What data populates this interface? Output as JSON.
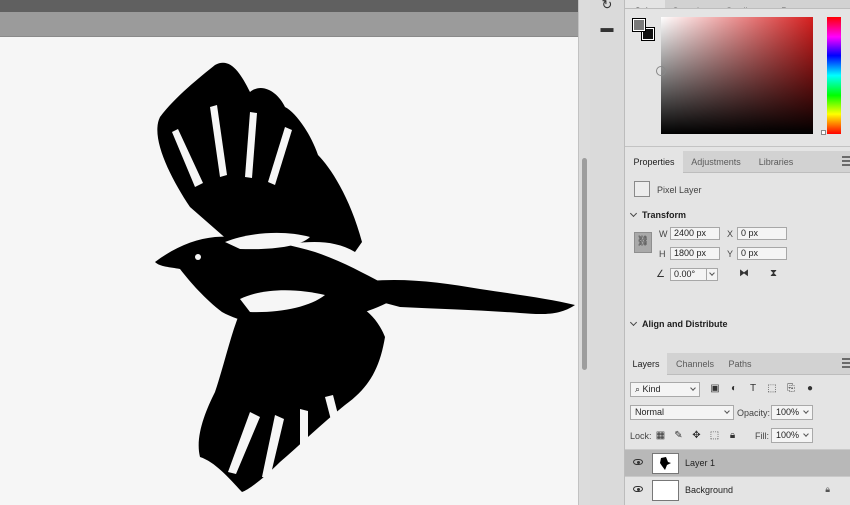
{
  "color_panel": {
    "tabs": [
      "Color",
      "Swatches",
      "Gradients",
      "Patterns"
    ]
  },
  "properties": {
    "tabs": [
      "Properties",
      "Adjustments",
      "Libraries"
    ],
    "layer_type": "Pixel Layer",
    "transform": {
      "title": "Transform",
      "w_label": "W",
      "w_value": "2400 px",
      "x_label": "X",
      "x_value": "0 px",
      "h_label": "H",
      "h_value": "1800 px",
      "y_label": "Y",
      "y_value": "0 px",
      "angle_value": "0.00°"
    },
    "align": {
      "title": "Align and Distribute"
    }
  },
  "layers_panel": {
    "tabs": [
      "Layers",
      "Channels",
      "Paths"
    ],
    "filter_kind": "Kind",
    "blend_mode": "Normal",
    "opacity_label": "Opacity:",
    "opacity_value": "100%",
    "lock_label": "Lock:",
    "fill_label": "Fill:",
    "fill_value": "100%",
    "layers": [
      {
        "name": "Layer 1",
        "selected": true
      },
      {
        "name": "Background",
        "locked": true
      }
    ]
  },
  "icons": {
    "top_strip": [
      "history-icon",
      "comment-icon"
    ],
    "filter_tools": [
      "image-filter-icon",
      "adjustment-filter-icon",
      "type-filter-icon",
      "shape-filter-icon",
      "smart-object-filter-icon",
      "filter-toggle-icon"
    ],
    "lock_tools": [
      "lock-transparent-icon",
      "lock-image-icon",
      "lock-position-icon",
      "lock-artboard-icon",
      "lock-all-icon"
    ]
  }
}
